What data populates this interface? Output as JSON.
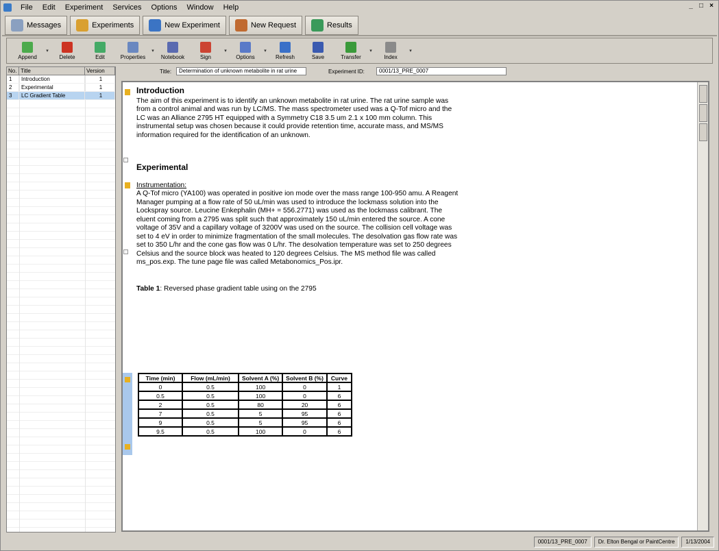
{
  "window": {
    "title": ""
  },
  "menubar": [
    "File",
    "Edit",
    "Experiment",
    "Services",
    "Options",
    "Window",
    "Help"
  ],
  "window_buttons": [
    "_",
    "□",
    "×"
  ],
  "navbar": [
    {
      "label": "Messages",
      "icon": "mail-icon",
      "color": "#8aa0c0"
    },
    {
      "label": "Experiments",
      "icon": "books-icon",
      "color": "#d9a030"
    },
    {
      "label": "New Experiment",
      "icon": "globe-icon",
      "color": "#3b74c4"
    },
    {
      "label": "New Request",
      "icon": "request-icon",
      "color": "#c06a30"
    },
    {
      "label": "Results",
      "icon": "results-icon",
      "color": "#3a9a5a"
    }
  ],
  "toolbar": [
    {
      "label": "Append",
      "icon": "append-icon",
      "color": "#4caa4c",
      "arrow": true
    },
    {
      "label": "Delete",
      "icon": "delete-icon",
      "color": "#cc3322",
      "arrow": false
    },
    {
      "label": "Edit",
      "icon": "edit-icon",
      "color": "#44aa66",
      "arrow": false
    },
    {
      "label": "Properties",
      "icon": "properties-icon",
      "color": "#6a88c0",
      "arrow": true
    },
    {
      "label": "Notebook",
      "icon": "notebook-icon",
      "color": "#5a6ab0",
      "arrow": false
    },
    {
      "label": "Sign",
      "icon": "pen-icon",
      "color": "#cc4433",
      "arrow": true
    },
    {
      "label": "Options",
      "icon": "options-icon",
      "color": "#5a7ac8",
      "arrow": true
    },
    {
      "label": "Refresh",
      "icon": "refresh-icon",
      "color": "#3a70c8",
      "arrow": false
    },
    {
      "label": "Save",
      "icon": "save-icon",
      "color": "#3a5ab0",
      "arrow": false
    },
    {
      "label": "Transfer",
      "icon": "transfer-icon",
      "color": "#3a9a3a",
      "arrow": true
    },
    {
      "label": "Index",
      "icon": "index-icon",
      "color": "#8a8a8a",
      "arrow": true
    }
  ],
  "section_list": {
    "headers": [
      "No.",
      "Title",
      "Version"
    ],
    "rows": [
      {
        "no": "1",
        "title": "Introduction",
        "version": "1"
      },
      {
        "no": "2",
        "title": "Experimental",
        "version": "1"
      },
      {
        "no": "3",
        "title": "LC Gradient Table",
        "version": "1"
      }
    ]
  },
  "fields": {
    "title_label": "Title:",
    "title_value": "Determination of unknown metabolite in rat urine",
    "experiment_label": "Experiment ID:",
    "experiment_value": "0001/13_PRE_0007"
  },
  "document": {
    "intro_heading": "Introduction",
    "intro_text": "The aim of this experiment is to identify an unknown metabolite in rat urine.  The rat urine sample was from a control animal and was run by LC/MS.  The mass spectrometer used was a Q-Tof micro and the LC was an Alliance 2795 HT equipped with a Symmetry C18 3.5 um 2.1 x 100 mm column.  This instrumental setup was chosen because it could provide retention time, accurate mass, and MS/MS information required for the identification of an unknown.",
    "exp_heading": "Experimental",
    "instr_heading": "Instrumentation:",
    "instr_text": "A Q-Tof micro (YA100) was operated in positive ion mode over the mass range 100-950 amu.  A Reagent Manager pumping at a flow rate of 50 uL/min was used to introduce the lockmass solution into the Lockspray source.  Leucine Enkephalin (MH+ = 556.2771) was used as the lockmass calibrant.  The eluent coming from a 2795 was split such that approximately 150 uL/min entered the source.   A cone voltage of 35V and a capillary voltage of 3200V was used on the source. The collision cell voltage was set to 4 eV in order to minimize fragmentation of the small molecules. The desolvation gas flow rate was set to 350 L/hr and the cone gas flow was 0 L/hr.  The desolvation temperature was set to 250 degrees Celsius and the source block was heated to 120 degrees Celsius. The MS method file was called ms_pos.exp. The tune page file was called Metabonomics_Pos.ipr.",
    "table_caption_bold": "Table 1",
    "table_caption_rest": ": Reversed phase gradient table using on the 2795",
    "table_headers": [
      "Time (min)",
      "Flow (mL/min)",
      "Solvent A (%)",
      "Solvent B (%)",
      "Curve"
    ],
    "table_rows": [
      [
        "0",
        "0.5",
        "100",
        "0",
        "1"
      ],
      [
        "0.5",
        "0.5",
        "100",
        "0",
        "6"
      ],
      [
        "2",
        "0.5",
        "80",
        "20",
        "6"
      ],
      [
        "7",
        "0.5",
        "5",
        "95",
        "6"
      ],
      [
        "9",
        "0.5",
        "5",
        "95",
        "6"
      ],
      [
        "9.5",
        "0.5",
        "100",
        "0",
        "6"
      ]
    ]
  },
  "status": [
    "0001/13_PRE_0007",
    "Dr. Elton Bengal or PaintCentre",
    "1/13/2004"
  ]
}
